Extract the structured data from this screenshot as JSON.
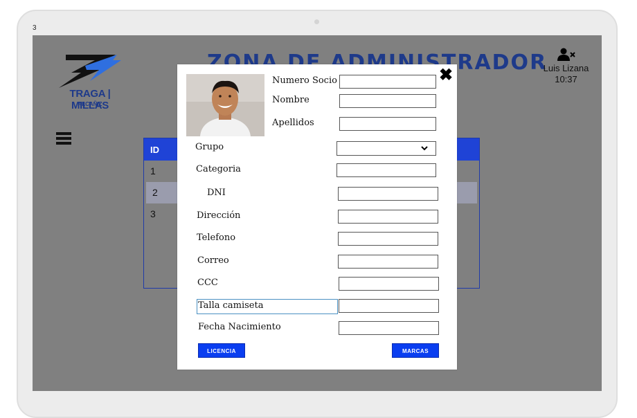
{
  "frame": {
    "corner_number": "3"
  },
  "header": {
    "logo_text": "TRAGA | MILLAS",
    "logo_sub": "ALCAÑIZ",
    "title": "ZONA DE ADMINISTRADOR",
    "user_name": "Luis Lizana",
    "time": "10:37",
    "user_icon": "user-remove-icon",
    "menu_icon": "hamburger-icon"
  },
  "table": {
    "header": "ID",
    "rows": [
      "1",
      "2",
      "3"
    ]
  },
  "modal": {
    "close_icon": "close-icon",
    "fields": {
      "numero_socio": "Numero Socio",
      "nombre": "Nombre",
      "apellidos": "Apellidos",
      "grupo": "Grupo",
      "categoria": "Categoria",
      "dni": "DNI",
      "direccion": "Dirección",
      "telefono": "Telefono",
      "correo": "Correo",
      "ccc": "CCC",
      "talla_camiseta": "Talla camiseta",
      "fecha_nacimiento": "Fecha Nacimiento"
    },
    "buttons": {
      "licencia": "LICENCIA",
      "marcas": "MARCAS"
    }
  },
  "colors": {
    "brand_blue": "#1e3a8a",
    "table_header": "#1f43d6",
    "button": "#0a3ef0",
    "screen_bg": "#808080"
  }
}
